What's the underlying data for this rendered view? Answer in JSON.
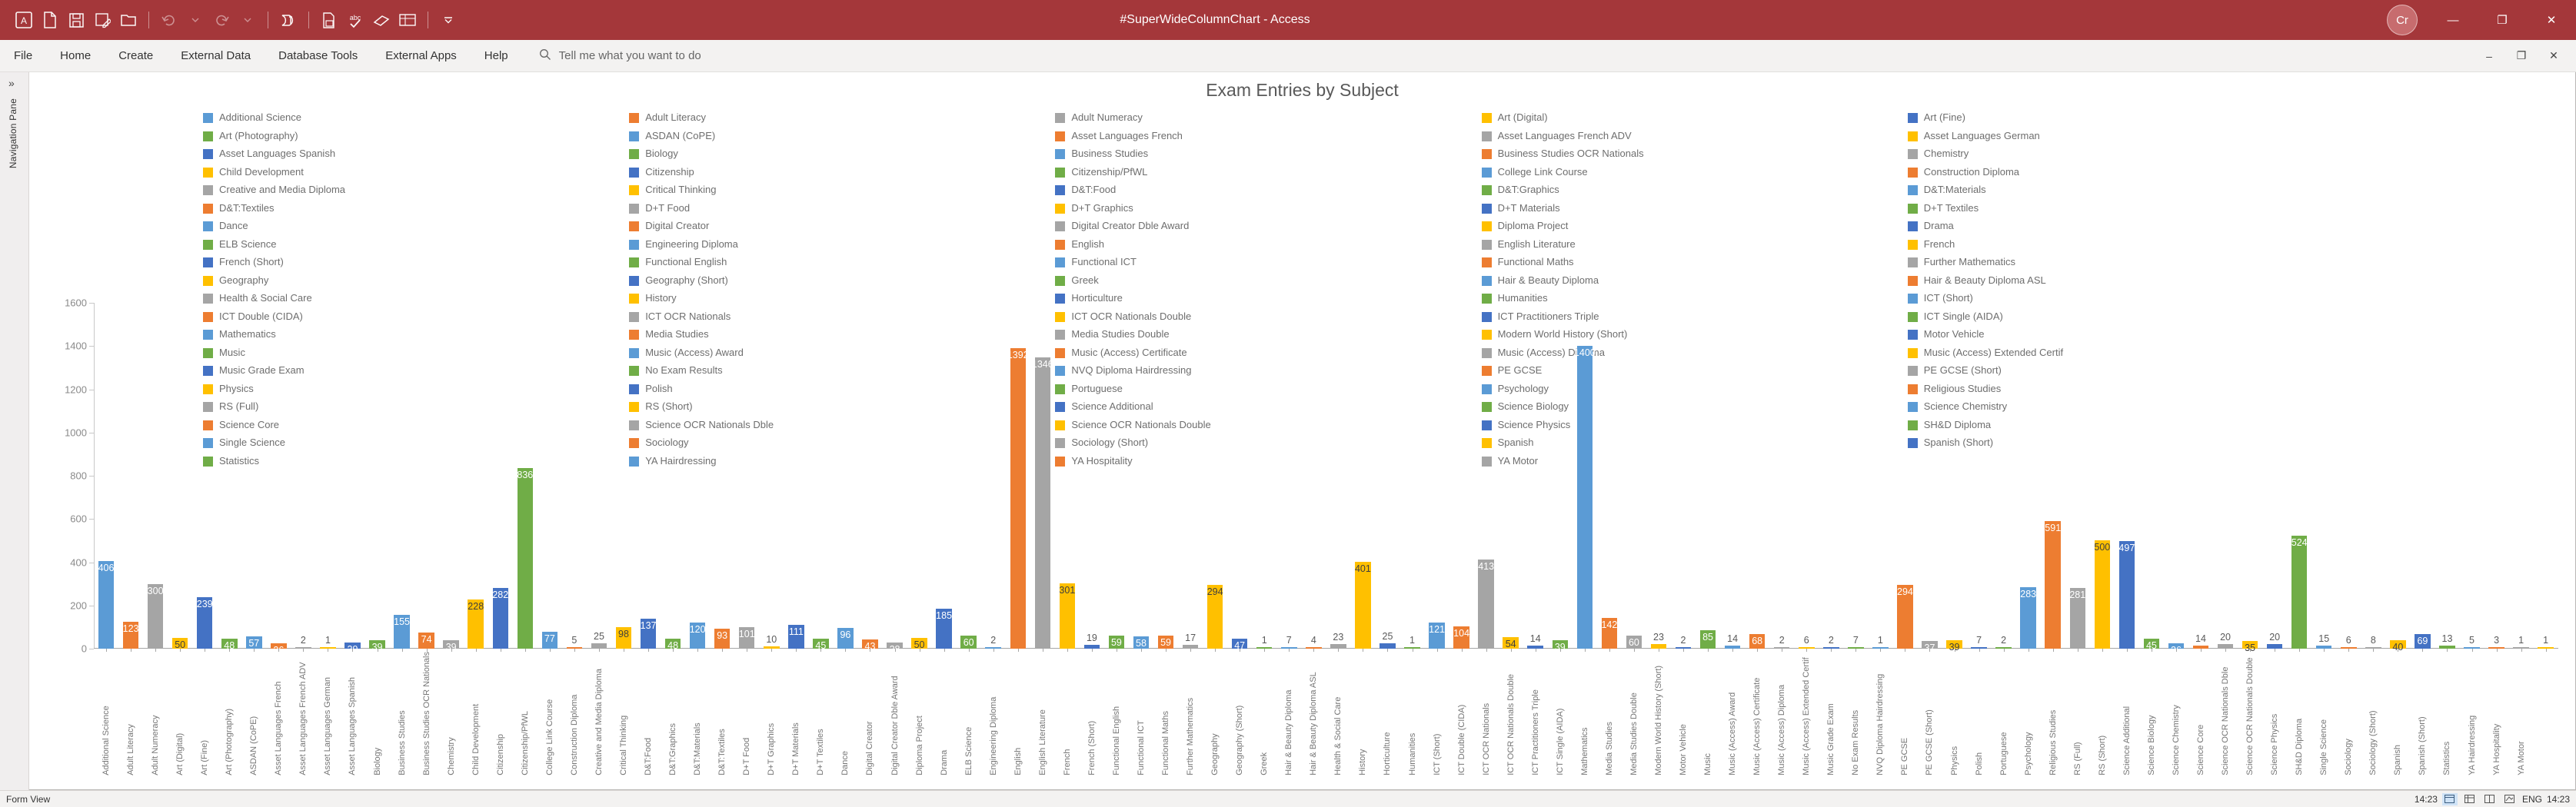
{
  "window": {
    "doc_title": "#SuperWideColumnChart  -  Access",
    "account_initial": "Cr",
    "minimize": "—",
    "maximize": "❐",
    "close": "✕"
  },
  "quick_access": [
    {
      "name": "access-logo-icon",
      "glyph": "A"
    },
    {
      "name": "new-file-icon",
      "glyph": "file"
    },
    {
      "name": "save-icon",
      "glyph": "save"
    },
    {
      "name": "save-as-icon",
      "glyph": "saveas"
    },
    {
      "name": "open-folder-icon",
      "glyph": "folder"
    },
    {
      "name": "undo-icon",
      "glyph": "undo"
    },
    {
      "name": "redo-icon",
      "glyph": "redo"
    },
    {
      "name": "tools-icon",
      "glyph": "tools"
    },
    {
      "name": "print-icon",
      "glyph": "print"
    },
    {
      "name": "spellcheck-icon",
      "glyph": "abc"
    },
    {
      "name": "format-painter-icon",
      "glyph": "brush"
    },
    {
      "name": "relationships-icon",
      "glyph": "rel"
    },
    {
      "name": "customize-quick-access-toolbar-icon",
      "glyph": "caret"
    }
  ],
  "ribbon": {
    "tabs": [
      "File",
      "Home",
      "Create",
      "External Data",
      "Database Tools",
      "External Apps",
      "Help"
    ],
    "tell_me": "Tell me what you want to do",
    "search_icon": "search-icon",
    "collapse_icon": "⌃",
    "minimize_ribbon": "–",
    "restore_window": "❐",
    "close_window": "✕"
  },
  "nav_pane": {
    "label": "Navigation Pane",
    "expand_icon": "»"
  },
  "status_bar": {
    "view_label": "Form View",
    "time": "14:23",
    "lang": "ENG",
    "clock": "14:23",
    "icons": [
      "form-view-icon",
      "datasheet-view-icon",
      "layout-view-icon",
      "design-view-icon"
    ]
  },
  "chart_data": {
    "type": "bar",
    "title": "Exam Entries by Subject",
    "xlabel": "",
    "ylabel": "",
    "ylim": [
      0,
      1600
    ],
    "yticks": [
      0,
      200,
      400,
      600,
      800,
      1000,
      1200,
      1400,
      1600
    ],
    "grid": false,
    "legend_position": "top",
    "palette": [
      "#5b9bd5",
      "#ed7d31",
      "#a5a5a5",
      "#ffc000",
      "#4472c4",
      "#70ad47"
    ],
    "categories": [
      "Additional Science",
      "Adult Literacy",
      "Adult Numeracy",
      "Art (Digital)",
      "Art (Fine)",
      "Art (Photography)",
      "ASDAN (CoPE)",
      "Asset Languages French",
      "Asset Languages French ADV",
      "Asset Languages German",
      "Asset Languages Spanish",
      "Biology",
      "Business Studies",
      "Business Studies OCR Nationals",
      "Chemistry",
      "Child Development",
      "Citizenship",
      "Citizenship/PfWL",
      "College Link Course",
      "Construction Diploma",
      "Creative and Media Diploma",
      "Critical Thinking",
      "D&T:Food",
      "D&T:Graphics",
      "D&T:Materials",
      "D&T:Textiles",
      "D+T Food",
      "D+T Graphics",
      "D+T Materials",
      "D+T Textiles",
      "Dance",
      "Digital Creator",
      "Digital Creator Dble Award",
      "Diploma Project",
      "Drama",
      "ELB Science",
      "Engineering Diploma",
      "English",
      "English Literature",
      "French",
      "French (Short)",
      "Functional English",
      "Functional ICT",
      "Functional Maths",
      "Further Mathematics",
      "Geography",
      "Geography (Short)",
      "Greek",
      "Hair & Beauty Diploma",
      "Hair & Beauty Diploma ASL",
      "Health & Social Care",
      "History",
      "Horticulture",
      "Humanities",
      "ICT (Short)",
      "ICT Double (CIDA)",
      "ICT OCR Nationals",
      "ICT OCR Nationals Double",
      "ICT Practitioners Triple",
      "ICT Single (AIDA)",
      "Mathematics",
      "Media Studies",
      "Media Studies Double",
      "Modern World History (Short)",
      "Motor Vehicle",
      "Music",
      "Music (Access) Award",
      "Music (Access) Certificate",
      "Music (Access) Diploma",
      "Music (Access) Extended Certif",
      "Music Grade Exam",
      "No Exam Results",
      "NVQ Diploma Hairdressing",
      "PE GCSE",
      "PE GCSE (Short)",
      "Physics",
      "Polish",
      "Portuguese",
      "Psychology",
      "Religious Studies",
      "RS (Full)",
      "RS (Short)",
      "Science Additional",
      "Science Biology",
      "Science Chemistry",
      "Science Core",
      "Science OCR Nationals Dble",
      "Science OCR Nationals Double",
      "Science Physics",
      "SH&D Diploma",
      "Single Science",
      "Sociology",
      "Sociology (Short)",
      "Spanish",
      "Spanish (Short)",
      "Statistics",
      "YA Hairdressing",
      "YA Hospitality",
      "YA Motor"
    ],
    "values": [
      406,
      123,
      300,
      50,
      239,
      48,
      57,
      26,
      2,
      1,
      29,
      39,
      155,
      74,
      39,
      228,
      282,
      836,
      77,
      5,
      25,
      98,
      137,
      48,
      120,
      93,
      101,
      10,
      111,
      45,
      96,
      43,
      28,
      50,
      185,
      60,
      2,
      1392,
      1346,
      301,
      19,
      59,
      58,
      59,
      17,
      294,
      47,
      1,
      7,
      4,
      23,
      401,
      25,
      1,
      121,
      104,
      413,
      54,
      14,
      39,
      1400,
      142,
      60,
      23,
      2,
      85,
      14,
      68,
      2,
      6,
      2,
      7,
      1,
      294,
      37,
      39,
      7,
      2,
      283,
      591,
      281,
      500,
      497,
      45,
      26,
      14,
      20,
      35,
      20,
      524,
      15,
      6,
      8,
      40,
      69,
      13,
      5,
      3,
      1,
      1
    ]
  },
  "legend": {
    "items": [
      {
        "label": "Additional Science",
        "color": "#5b9bd5"
      },
      {
        "label": "Adult Literacy",
        "color": "#ed7d31"
      },
      {
        "label": "Adult Numeracy",
        "color": "#a5a5a5"
      },
      {
        "label": "Art (Digital)",
        "color": "#ffc000"
      },
      {
        "label": "Art (Fine)",
        "color": "#4472c4"
      },
      {
        "label": "Art (Photography)",
        "color": "#70ad47"
      },
      {
        "label": "ASDAN (CoPE)",
        "color": "#5b9bd5"
      },
      {
        "label": "Asset Languages French",
        "color": "#ed7d31"
      },
      {
        "label": "Asset Languages French ADV",
        "color": "#a5a5a5"
      },
      {
        "label": "Asset Languages German",
        "color": "#ffc000"
      },
      {
        "label": "Asset Languages Spanish",
        "color": "#4472c4"
      },
      {
        "label": "Biology",
        "color": "#70ad47"
      },
      {
        "label": "Business Studies",
        "color": "#5b9bd5"
      },
      {
        "label": "Business Studies OCR Nationals",
        "color": "#ed7d31"
      },
      {
        "label": "Chemistry",
        "color": "#a5a5a5"
      },
      {
        "label": "Child Development",
        "color": "#ffc000"
      },
      {
        "label": "Citizenship",
        "color": "#4472c4"
      },
      {
        "label": "Citizenship/PfWL",
        "color": "#70ad47"
      },
      {
        "label": "College Link Course",
        "color": "#5b9bd5"
      },
      {
        "label": "Construction Diploma",
        "color": "#ed7d31"
      },
      {
        "label": "Creative and Media Diploma",
        "color": "#a5a5a5"
      },
      {
        "label": "Critical Thinking",
        "color": "#ffc000"
      },
      {
        "label": "D&T:Food",
        "color": "#4472c4"
      },
      {
        "label": "D&T:Graphics",
        "color": "#70ad47"
      },
      {
        "label": "D&T:Materials",
        "color": "#5b9bd5"
      },
      {
        "label": "D&T:Textiles",
        "color": "#ed7d31"
      },
      {
        "label": "D+T Food",
        "color": "#a5a5a5"
      },
      {
        "label": "D+T Graphics",
        "color": "#ffc000"
      },
      {
        "label": "D+T Materials",
        "color": "#4472c4"
      },
      {
        "label": "D+T Textiles",
        "color": "#70ad47"
      },
      {
        "label": "Dance",
        "color": "#5b9bd5"
      },
      {
        "label": "Digital Creator",
        "color": "#ed7d31"
      },
      {
        "label": "Digital Creator Dble Award",
        "color": "#a5a5a5"
      },
      {
        "label": "Diploma Project",
        "color": "#ffc000"
      },
      {
        "label": "Drama",
        "color": "#4472c4"
      },
      {
        "label": "ELB Science",
        "color": "#70ad47"
      },
      {
        "label": "Engineering Diploma",
        "color": "#5b9bd5"
      },
      {
        "label": "English",
        "color": "#ed7d31"
      },
      {
        "label": "English Literature",
        "color": "#a5a5a5"
      },
      {
        "label": "French",
        "color": "#ffc000"
      },
      {
        "label": "French (Short)",
        "color": "#4472c4"
      },
      {
        "label": "Functional English",
        "color": "#70ad47"
      },
      {
        "label": "Functional ICT",
        "color": "#5b9bd5"
      },
      {
        "label": "Functional Maths",
        "color": "#ed7d31"
      },
      {
        "label": "Further Mathematics",
        "color": "#a5a5a5"
      },
      {
        "label": "Geography",
        "color": "#ffc000"
      },
      {
        "label": "Geography (Short)",
        "color": "#4472c4"
      },
      {
        "label": "Greek",
        "color": "#70ad47"
      },
      {
        "label": "Hair & Beauty Diploma",
        "color": "#5b9bd5"
      },
      {
        "label": "Hair & Beauty Diploma ASL",
        "color": "#ed7d31"
      },
      {
        "label": "Health & Social Care",
        "color": "#a5a5a5"
      },
      {
        "label": "History",
        "color": "#ffc000"
      },
      {
        "label": "Horticulture",
        "color": "#4472c4"
      },
      {
        "label": "Humanities",
        "color": "#70ad47"
      },
      {
        "label": "ICT (Short)",
        "color": "#5b9bd5"
      },
      {
        "label": "ICT Double (CIDA)",
        "color": "#ed7d31"
      },
      {
        "label": "ICT OCR Nationals",
        "color": "#a5a5a5"
      },
      {
        "label": "ICT OCR Nationals Double",
        "color": "#ffc000"
      },
      {
        "label": "ICT Practitioners Triple",
        "color": "#4472c4"
      },
      {
        "label": "ICT Single (AIDA)",
        "color": "#70ad47"
      },
      {
        "label": "Mathematics",
        "color": "#5b9bd5"
      },
      {
        "label": "Media Studies",
        "color": "#ed7d31"
      },
      {
        "label": "Media Studies Double",
        "color": "#a5a5a5"
      },
      {
        "label": "Modern World History (Short)",
        "color": "#ffc000"
      },
      {
        "label": "Motor Vehicle",
        "color": "#4472c4"
      },
      {
        "label": "Music",
        "color": "#70ad47"
      },
      {
        "label": "Music (Access) Award",
        "color": "#5b9bd5"
      },
      {
        "label": "Music (Access) Certificate",
        "color": "#ed7d31"
      },
      {
        "label": "Music (Access) Diploma",
        "color": "#a5a5a5"
      },
      {
        "label": "Music (Access) Extended Certif",
        "color": "#ffc000"
      },
      {
        "label": "Music Grade Exam",
        "color": "#4472c4"
      },
      {
        "label": "No Exam Results",
        "color": "#70ad47"
      },
      {
        "label": "NVQ Diploma Hairdressing",
        "color": "#5b9bd5"
      },
      {
        "label": "PE GCSE",
        "color": "#ed7d31"
      },
      {
        "label": "PE GCSE (Short)",
        "color": "#a5a5a5"
      },
      {
        "label": "Physics",
        "color": "#ffc000"
      },
      {
        "label": "Polish",
        "color": "#4472c4"
      },
      {
        "label": "Portuguese",
        "color": "#70ad47"
      },
      {
        "label": "Psychology",
        "color": "#5b9bd5"
      },
      {
        "label": "Religious Studies",
        "color": "#ed7d31"
      },
      {
        "label": "RS (Full)",
        "color": "#a5a5a5"
      },
      {
        "label": "RS (Short)",
        "color": "#ffc000"
      },
      {
        "label": "Science Additional",
        "color": "#4472c4"
      },
      {
        "label": "Science Biology",
        "color": "#70ad47"
      },
      {
        "label": "Science Chemistry",
        "color": "#5b9bd5"
      },
      {
        "label": "Science Core",
        "color": "#ed7d31"
      },
      {
        "label": "Science OCR Nationals Dble",
        "color": "#a5a5a5"
      },
      {
        "label": "Science OCR Nationals Double",
        "color": "#ffc000"
      },
      {
        "label": "Science Physics",
        "color": "#4472c4"
      },
      {
        "label": "SH&D Diploma",
        "color": "#70ad47"
      },
      {
        "label": "Single Science",
        "color": "#5b9bd5"
      },
      {
        "label": "Sociology",
        "color": "#ed7d31"
      },
      {
        "label": "Sociology (Short)",
        "color": "#a5a5a5"
      },
      {
        "label": "Spanish",
        "color": "#ffc000"
      },
      {
        "label": "Spanish (Short)",
        "color": "#4472c4"
      },
      {
        "label": "Statistics",
        "color": "#70ad47"
      },
      {
        "label": "YA Hairdressing",
        "color": "#5b9bd5"
      },
      {
        "label": "YA Hospitality",
        "color": "#ed7d31"
      },
      {
        "label": "YA Motor",
        "color": "#a5a5a5"
      }
    ]
  }
}
